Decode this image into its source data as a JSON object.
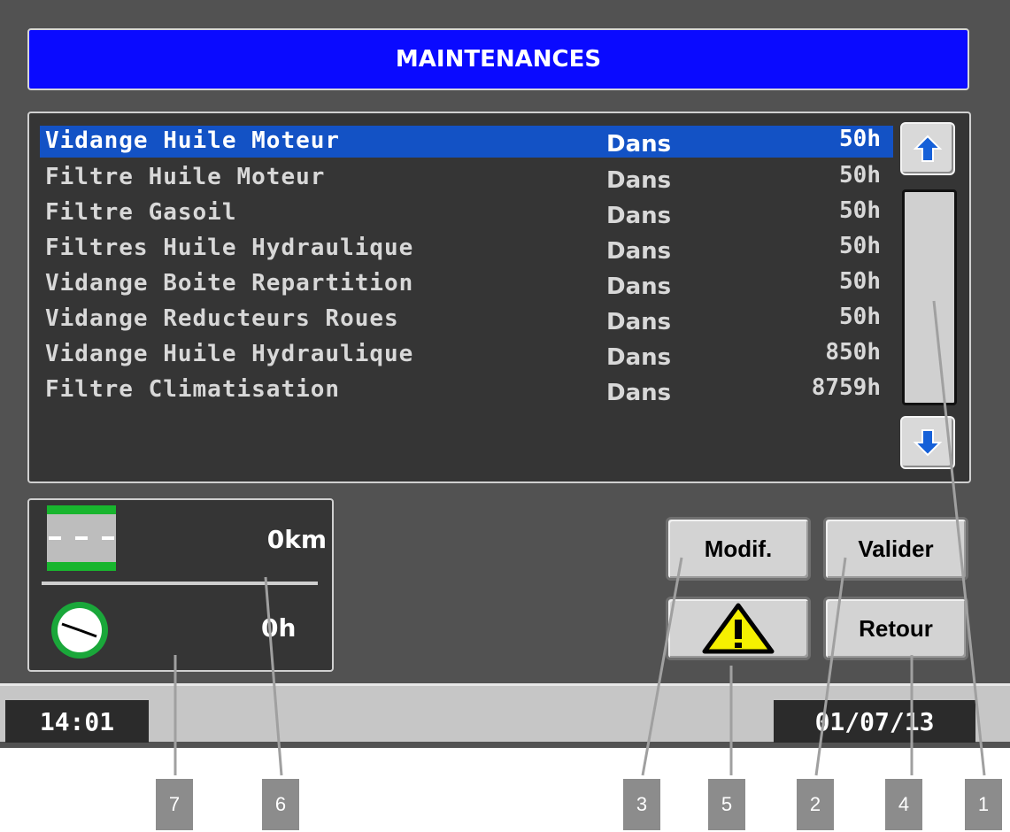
{
  "header": {
    "title": "MAINTENANCES"
  },
  "maintenance_list": {
    "items": [
      {
        "name": "Vidange Huile Moteur",
        "when": "Dans",
        "hours": "50h",
        "selected": true
      },
      {
        "name": "Filtre Huile Moteur",
        "when": "Dans",
        "hours": "50h"
      },
      {
        "name": "Filtre Gasoil",
        "when": "Dans",
        "hours": "50h"
      },
      {
        "name": "Filtres Huile Hydraulique",
        "when": "Dans",
        "hours": "50h"
      },
      {
        "name": "Vidange Boite Repartition",
        "when": "Dans",
        "hours": "50h"
      },
      {
        "name": "Vidange Reducteurs Roues",
        "when": "Dans",
        "hours": "50h"
      },
      {
        "name": "Vidange Huile Hydraulique",
        "when": "Dans",
        "hours": "850h"
      },
      {
        "name": "Filtre Climatisation",
        "when": "Dans",
        "hours": "8759h"
      }
    ]
  },
  "scrollbar": {
    "up_icon": "arrow-up-icon",
    "down_icon": "arrow-down-icon"
  },
  "info": {
    "distance": "0km",
    "hours": "0h",
    "road_icon": "road-icon",
    "clock_icon": "clock-icon"
  },
  "buttons": {
    "modify": "Modif.",
    "validate": "Valider",
    "back": "Retour",
    "warning_icon": "warning-icon"
  },
  "status_bar": {
    "time": "14:01",
    "date": "01/07/13"
  },
  "callouts": [
    "1",
    "2",
    "3",
    "4",
    "5",
    "6",
    "7"
  ],
  "colors": {
    "title_bar": "#0a0aff",
    "selected_row": "#1352c5",
    "background": "#525252",
    "panel": "#353535"
  }
}
